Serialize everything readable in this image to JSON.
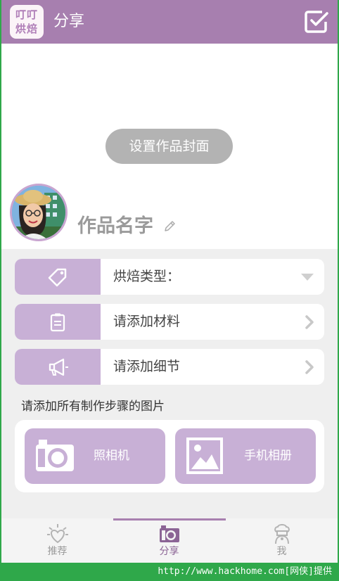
{
  "header": {
    "logo_line1": "叮叮",
    "logo_line2": "烘焙",
    "title": "分享"
  },
  "cover": {
    "set_cover_label": "设置作品封面",
    "work_name": "作品名字"
  },
  "rows": [
    {
      "label": "烘焙类型：",
      "icon": "tag-icon",
      "indicator": "dropdown-triangle"
    },
    {
      "label": "请添加材料",
      "icon": "clipboard-icon",
      "indicator": "chevron-right"
    },
    {
      "label": "请添加细节",
      "icon": "megaphone-icon",
      "indicator": "chevron-right"
    }
  ],
  "steps_hint": "请添加所有制作步骤的图片",
  "photo_buttons": {
    "camera_label": "照相机",
    "album_label": "手机相册"
  },
  "tabs": [
    {
      "label": "推荐",
      "icon": "sun-heart-icon",
      "active": false
    },
    {
      "label": "分享",
      "icon": "camera-icon",
      "active": true
    },
    {
      "label": "我",
      "icon": "chef-icon",
      "active": false
    }
  ],
  "watermark": "http://www.hackhome.com[网侠]提供",
  "colors": {
    "header_bg": "#a77faf",
    "accent_light": "#c8b0d6",
    "page_bg": "#efefef",
    "watermark_bar": "#2fa84a"
  }
}
